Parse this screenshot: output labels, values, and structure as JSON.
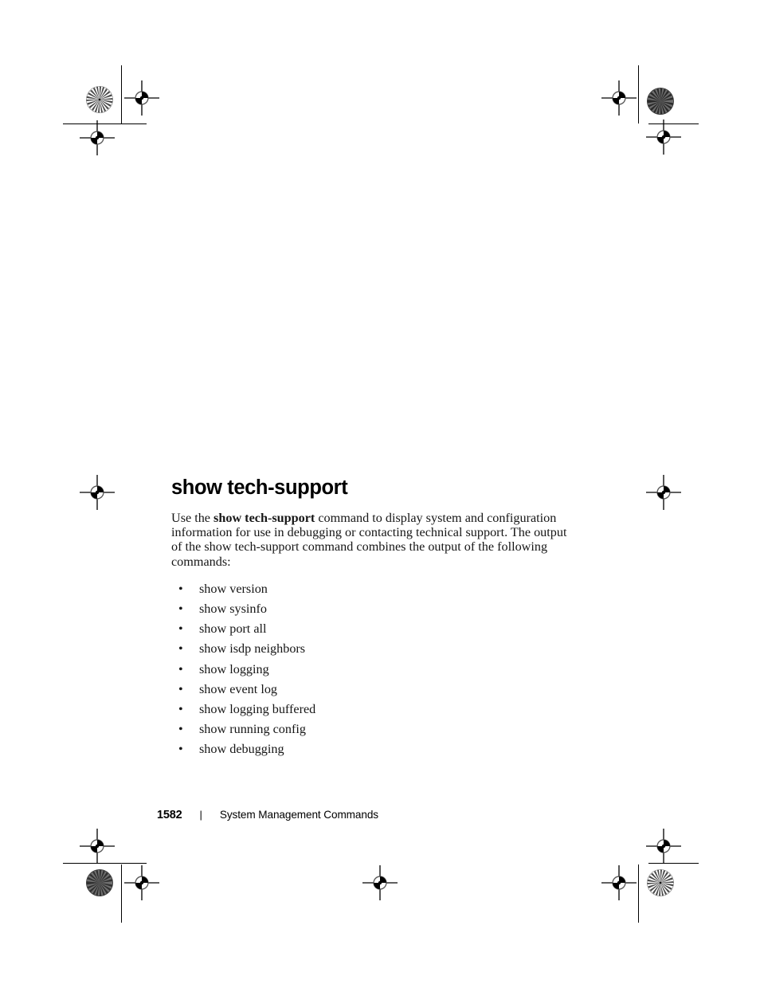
{
  "page": {
    "heading": "show tech-support",
    "paragraph": {
      "before_bold": "Use the ",
      "bold_command": "show tech-support",
      "after_bold": " command to display system and configuration information for use in debugging or contacting technical support. The output of the show tech-support command combines the output of the following commands:"
    },
    "bullet_marker": "•",
    "commands": [
      "show version",
      "show sysinfo",
      "show port all",
      "show isdp neighbors",
      "show logging",
      "show event log",
      "show logging buffered",
      "show running config",
      "show debugging"
    ]
  },
  "footer": {
    "page_number": "1582",
    "separator": "|",
    "section_title": "System Management Commands"
  },
  "print_marks": {
    "registration_target_name": "registration-target",
    "star_target_name": "star-target",
    "crop_mark_name": "crop-mark"
  }
}
